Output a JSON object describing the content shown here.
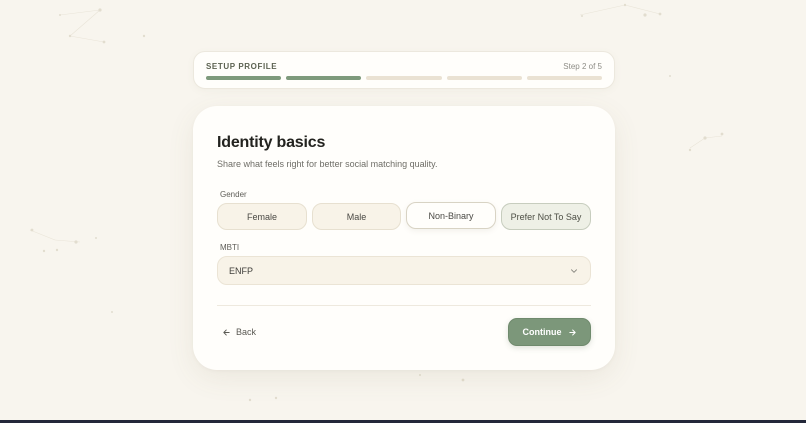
{
  "progress": {
    "title": "SETUP PROFILE",
    "step_text": "Step 2 of 5",
    "total_steps": 5,
    "completed_steps": 2
  },
  "card": {
    "title": "Identity basics",
    "subtitle": "Share what feels right for better social matching quality."
  },
  "gender": {
    "label": "Gender",
    "options": [
      "Female",
      "Male",
      "Non-Binary",
      "Prefer Not To Say"
    ],
    "selected": "Prefer Not To Say"
  },
  "mbti": {
    "label": "MBTI",
    "value": "ENFP"
  },
  "actions": {
    "back_label": "Back",
    "continue_label": "Continue"
  },
  "colors": {
    "accent": "#7c977a",
    "background": "#f8f5ee",
    "card": "#fffefb",
    "progress_inactive": "#eae2d3"
  },
  "icons": {
    "back": "arrow-left-icon",
    "continue": "arrow-right-icon",
    "select": "chevron-down-icon"
  }
}
